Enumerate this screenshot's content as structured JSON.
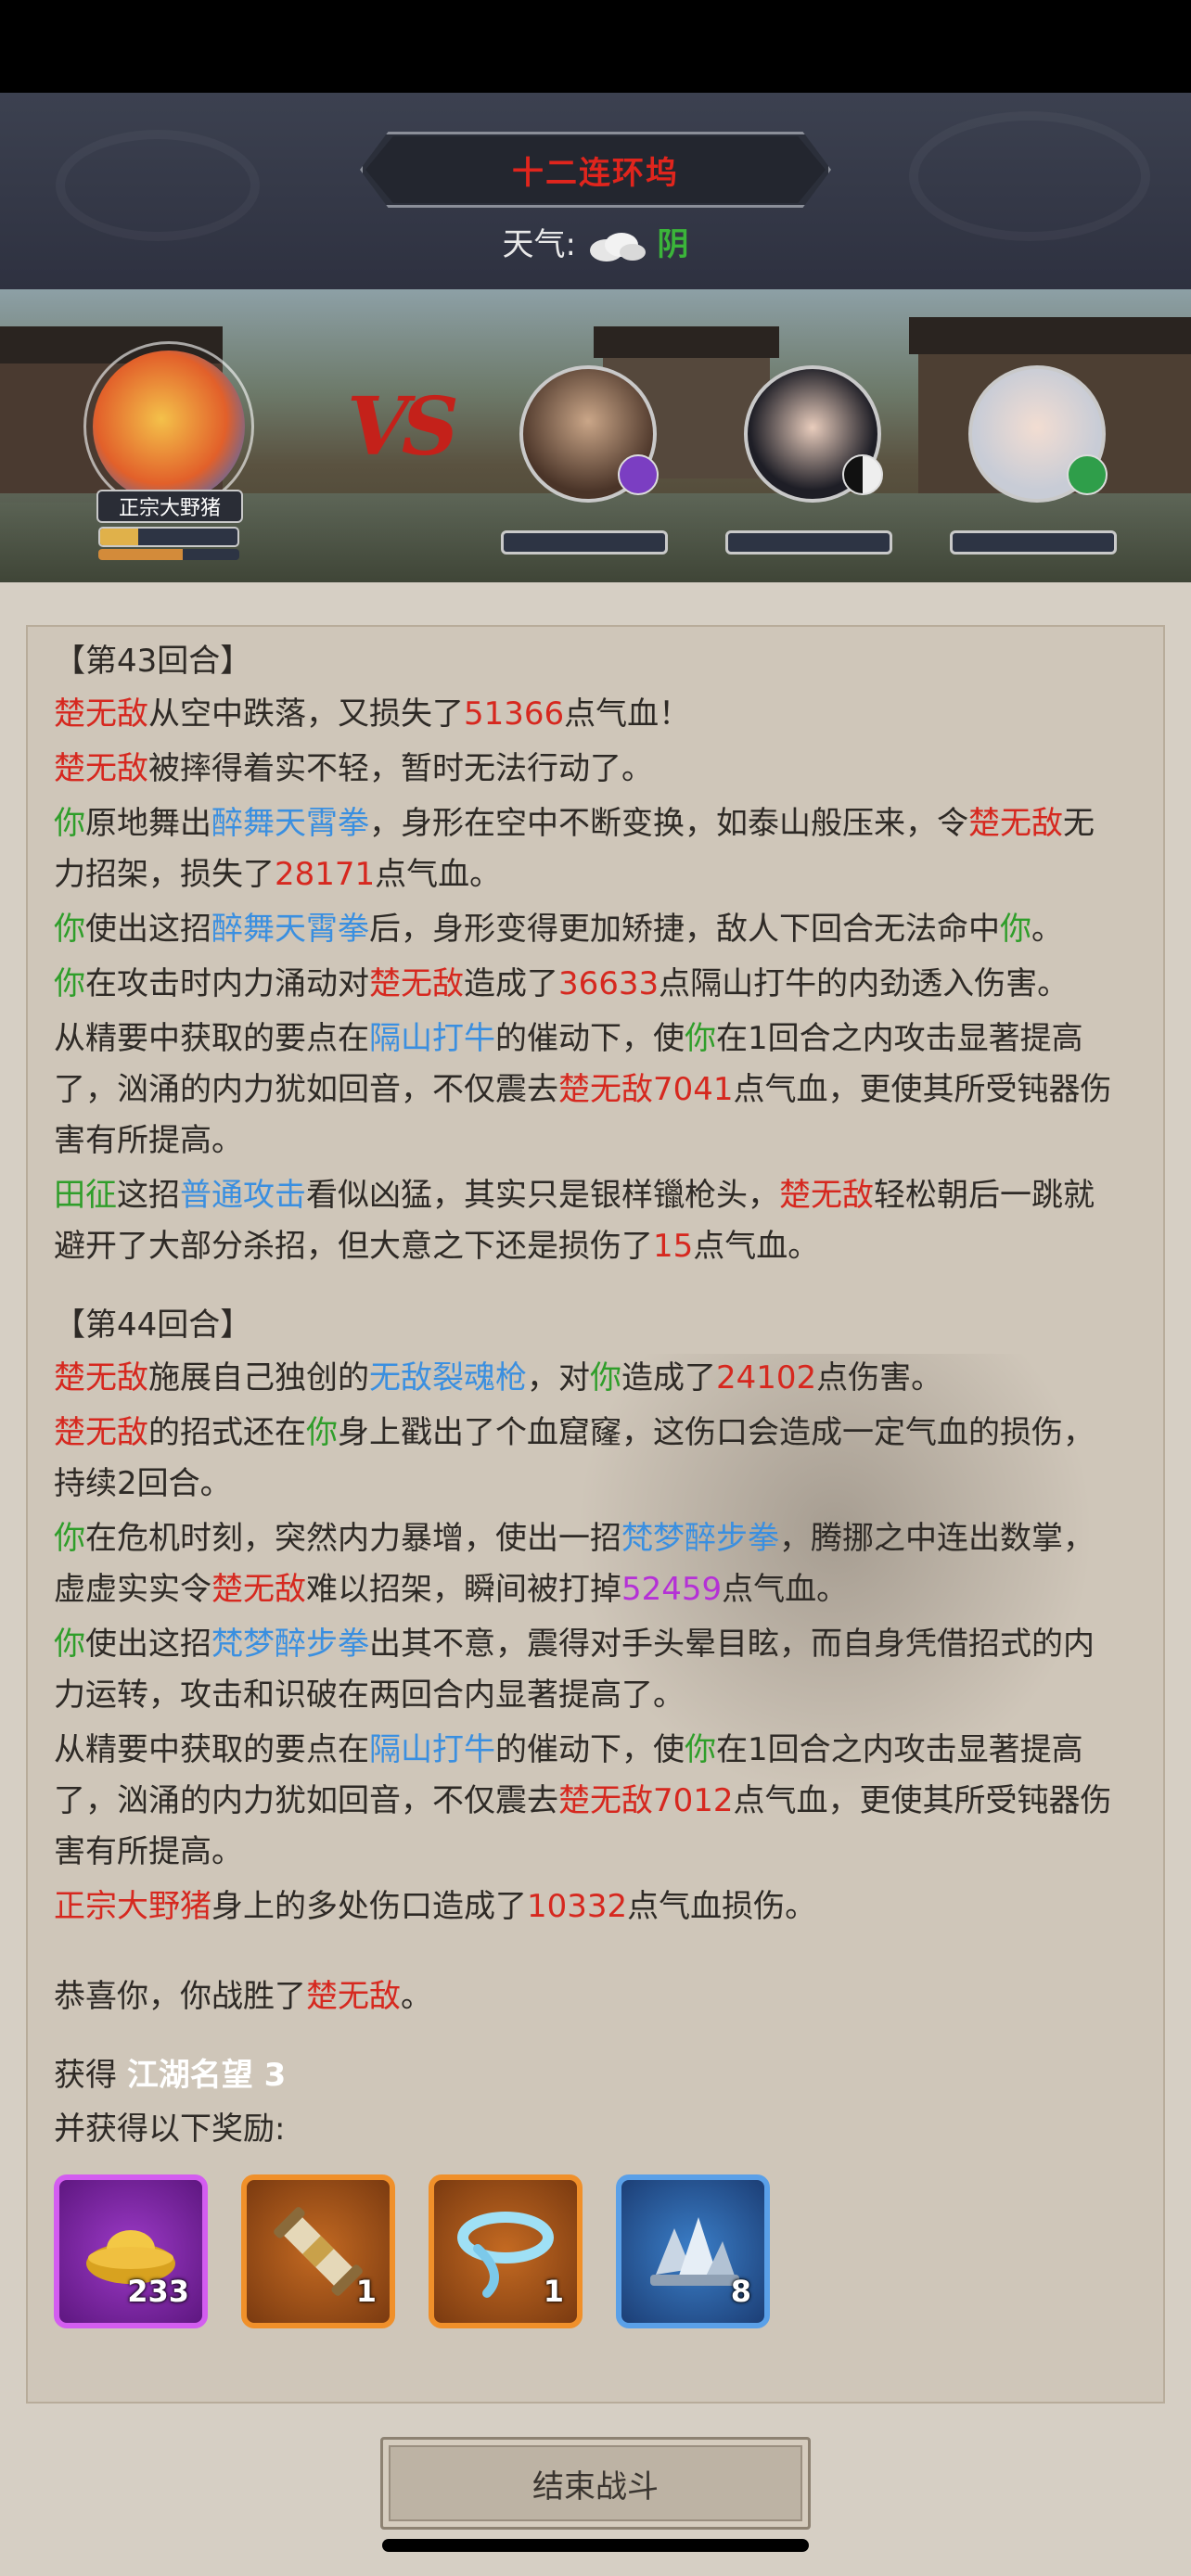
{
  "header": {
    "location": "十二连环坞",
    "weather_label": "天气:",
    "weather_value": "阴",
    "weather_icon": "cloud-icon"
  },
  "battle": {
    "player_name": "正宗大野猪",
    "vs_label": "VS",
    "enemies": [
      {
        "portrait": "bearded-warrior-portrait",
        "badge": "purple-star-badge"
      },
      {
        "portrait": "dark-haired-lady-portrait",
        "badge": "yin-yang-badge"
      },
      {
        "portrait": "white-haired-lady-portrait",
        "badge": "green-arrow-badge"
      }
    ]
  },
  "log": {
    "round43": "【第43回合】",
    "round44": "【第44回合】",
    "e1": {
      "a": "楚无敌",
      "b": "从空中跌落，又损失了",
      "c": "51366",
      "d": "点气血！"
    },
    "e2": {
      "a": "楚无敌",
      "b": "被摔得着实不轻，暂时无法行动了。"
    },
    "e3": {
      "a": "你",
      "b": "原地舞出",
      "c": "醉舞天霄拳",
      "d": "，身形在空中不断变换，如泰山般压来，令",
      "e": "楚无敌",
      "f": "无力招架，损失了",
      "g": "28171",
      "h": "点气血。"
    },
    "e4": {
      "a": "你",
      "b": "使出这招",
      "c": "醉舞天霄拳",
      "d": "后，身形变得更加矫捷，敌人下回合无法命中",
      "e": "你",
      "f": "。"
    },
    "e5": {
      "a": "你",
      "b": "在攻击时内力涌动对",
      "c": "楚无敌",
      "d": "造成了",
      "e": "36633",
      "f": "点隔山打牛的内劲透入伤害。"
    },
    "e6": {
      "a": "从精要中获取的要点在",
      "b": "隔山打牛",
      "c": "的催动下，使",
      "d": "你",
      "e": "在1回合之内攻击显著提高了，汹涌的内力犹如回音，不仅震去",
      "f": "楚无敌7041",
      "g": "点气血，更使其所受钝器伤害有所提高。"
    },
    "e7": {
      "a": "田征",
      "b": "这招",
      "c": "普通攻击",
      "d": "看似凶猛，其实只是银样镴枪头，",
      "e": "楚无敌",
      "f": "轻松朝后一跳就避开了大部分杀招，但大意之下还是损伤了",
      "g": "15",
      "h": "点气血。"
    },
    "f1": {
      "a": "楚无敌",
      "b": "施展自己独创的",
      "c": "无敌裂魂枪",
      "d": "，对",
      "e": "你",
      "f": "造成了",
      "g": "24102",
      "h": "点伤害。"
    },
    "f2": {
      "a": "楚无敌",
      "b": "的招式还在",
      "c": "你",
      "d": "身上戳出了个血窟窿，这伤口会造成一定气血的损伤，持续2回合。"
    },
    "f3": {
      "a": "你",
      "b": "在危机时刻，突然内力暴增，使出一招",
      "c": "梵梦醉步拳",
      "d": "，腾挪之中连出数掌，虚虚实实令",
      "e": "楚无敌",
      "f": "难以招架，瞬间被打掉",
      "g": "52459",
      "h": "点气血。"
    },
    "f4": {
      "a": "你",
      "b": "使出这招",
      "c": "梵梦醉步拳",
      "d": "出其不意，震得对手头晕目眩，而自身凭借招式的内力运转，攻击和识破在两回合内显著提高了。"
    },
    "f5": {
      "a": "从精要中获取的要点在",
      "b": "隔山打牛",
      "c": "的催动下，使",
      "d": "你",
      "e": "在1回合之内攻击显著提高了，汹涌的内力犹如回音，不仅震去",
      "f": "楚无敌7012",
      "g": "点气血，更使其所受钝器伤害有所提高。"
    },
    "f6": {
      "a": "正宗大野猪",
      "b": "身上的多处伤口造成了",
      "c": "10332",
      "d": "点气血损伤。"
    },
    "win": {
      "a": "恭喜你，你战胜了",
      "b": "楚无敌",
      "c": "。"
    }
  },
  "rewards": {
    "gain_label": "获得",
    "reputation": "江湖名望 3",
    "also_label": "并获得以下奖励:",
    "items": [
      {
        "icon": "gold-ingot-icon",
        "qty": "233",
        "rarity": "purple"
      },
      {
        "icon": "scroll-icon",
        "qty": "1",
        "rarity": "orange"
      },
      {
        "icon": "blue-swirl-icon",
        "qty": "1",
        "rarity": "orange"
      },
      {
        "icon": "crystal-ore-icon",
        "qty": "8",
        "rarity": "blue"
      }
    ]
  },
  "end_button": "结束战斗",
  "colors": {
    "enemy_red": "#d6281f",
    "player_green": "#2f9e2a",
    "skill_blue": "#3a8fe0",
    "crit_purple": "#b531d6"
  }
}
